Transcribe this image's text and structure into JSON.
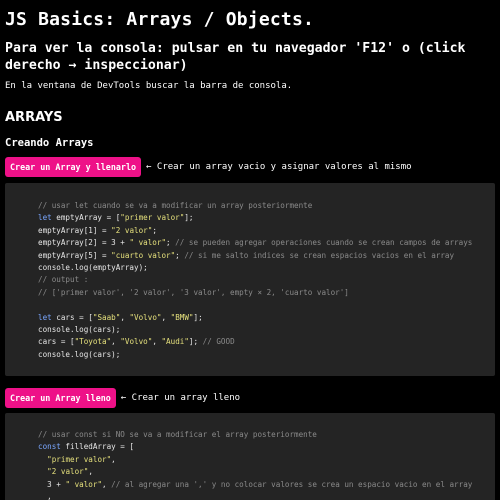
{
  "page": {
    "title": "JS Basics: Arrays / Objects.",
    "console_hint": "Para ver la consola: pulsar en tu navegador 'F12' o (click derecho → inspeccionar)",
    "devtools_hint": "En la ventana de DevTools buscar la barra de consola.",
    "section_title": "ARRAYS",
    "subsection_title": "Creando Arrays"
  },
  "examples": [
    {
      "button_label": "Crear un Array y llenarlo",
      "description": "← Crear un array vacio y asignar valores al mismo",
      "code": [
        [
          [
            "cm",
            "// usar let cuando se va a modificar un array posteriormente"
          ]
        ],
        [
          [
            "kw",
            "let"
          ],
          [
            "txt",
            " emptyArray = ["
          ],
          [
            "str",
            "\"primer valor\""
          ],
          [
            "txt",
            "];"
          ]
        ],
        [
          [
            "txt",
            "emptyArray[1] = "
          ],
          [
            "str",
            "\"2 valor\""
          ],
          [
            "txt",
            ";"
          ]
        ],
        [
          [
            "txt",
            "emptyArray[2] = 3 + "
          ],
          [
            "str",
            "\" valor\""
          ],
          [
            "txt",
            "; "
          ],
          [
            "cm",
            "// se pueden agregar operaciones cuando se crean campos de arrays"
          ]
        ],
        [
          [
            "txt",
            "emptyArray[5] = "
          ],
          [
            "str",
            "\"cuarto valor\""
          ],
          [
            "txt",
            "; "
          ],
          [
            "cm",
            "// si me salto indices se crean espacios vacios en el array"
          ]
        ],
        [
          [
            "txt",
            "console.log(emptyArray);"
          ]
        ],
        [
          [
            "cm",
            "// output :"
          ]
        ],
        [
          [
            "cm",
            "// ['primer valor', '2 valor', '3 valor', empty × 2, 'cuarto valor']"
          ]
        ],
        [
          [
            "txt",
            ""
          ]
        ],
        [
          [
            "kw",
            "let"
          ],
          [
            "txt",
            " cars = ["
          ],
          [
            "str",
            "\"Saab\""
          ],
          [
            "txt",
            ", "
          ],
          [
            "str",
            "\"Volvo\""
          ],
          [
            "txt",
            ", "
          ],
          [
            "str",
            "\"BMW\""
          ],
          [
            "txt",
            "];"
          ]
        ],
        [
          [
            "txt",
            "console.log(cars);"
          ]
        ],
        [
          [
            "txt",
            "cars = ["
          ],
          [
            "str",
            "\"Toyota\""
          ],
          [
            "txt",
            ", "
          ],
          [
            "str",
            "\"Volvo\""
          ],
          [
            "txt",
            ", "
          ],
          [
            "str",
            "\"Audi\""
          ],
          [
            "txt",
            "]; "
          ],
          [
            "cm",
            "// GOOD"
          ]
        ],
        [
          [
            "txt",
            "console.log(cars);"
          ]
        ]
      ]
    },
    {
      "button_label": "Crear un Array lleno",
      "description": "← Crear un array lleno",
      "code": [
        [
          [
            "cm",
            "// usar const si NO se va a modificar el array posteriormente"
          ]
        ],
        [
          [
            "kw",
            "const"
          ],
          [
            "txt",
            " filledArray = ["
          ]
        ],
        [
          [
            "txt",
            "  "
          ],
          [
            "str",
            "\"primer valor\""
          ],
          [
            "txt",
            ","
          ]
        ],
        [
          [
            "txt",
            "  "
          ],
          [
            "str",
            "\"2 valor\""
          ],
          [
            "txt",
            ","
          ]
        ],
        [
          [
            "txt",
            "  3 + "
          ],
          [
            "str",
            "\" valor\""
          ],
          [
            "txt",
            ", "
          ],
          [
            "cm",
            "// al agregar una ',' y no colocar valores se crea un espacio vacio en el array"
          ]
        ],
        [
          [
            "txt",
            "  ,"
          ]
        ]
      ]
    }
  ]
}
